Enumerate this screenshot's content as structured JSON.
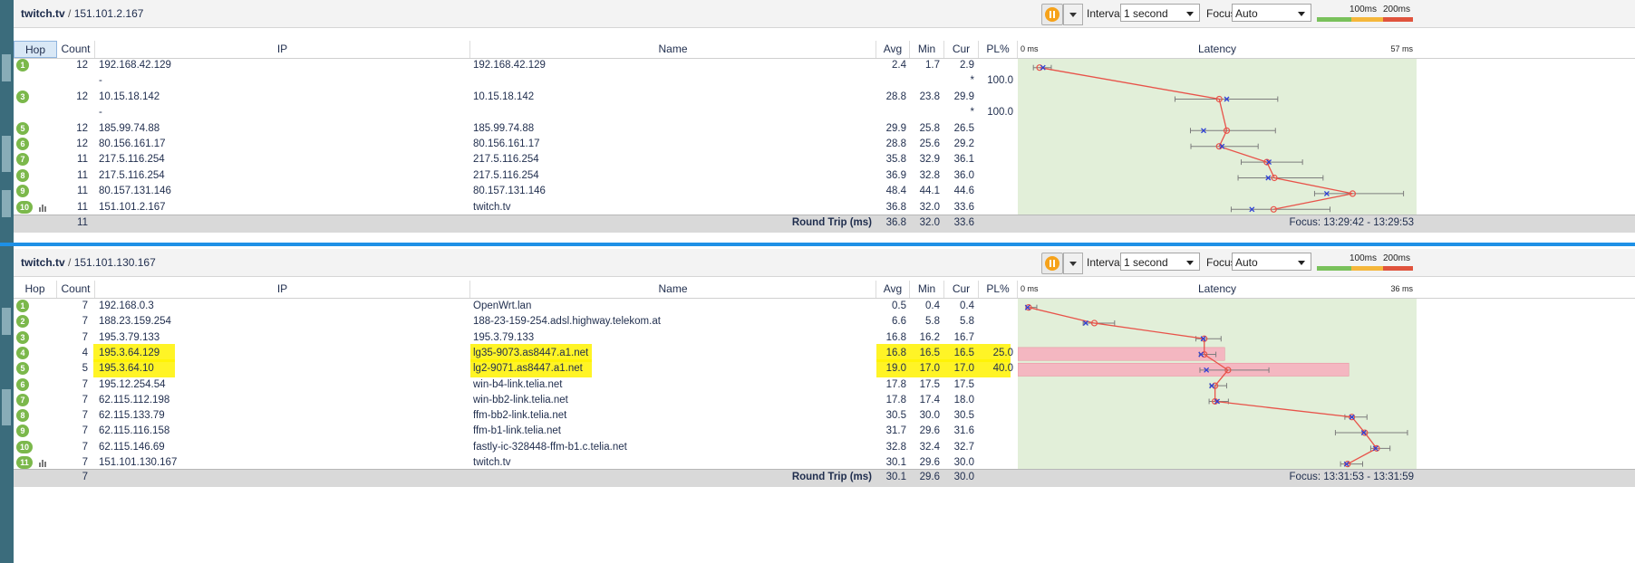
{
  "top": {
    "title_host": "twitch.tv",
    "title_ip": "151.101.2.167",
    "interval_label": "Interval",
    "interval_value": "1 second",
    "focus_label": "Focus",
    "focus_value": "Auto",
    "scale": {
      "t1": "100ms",
      "t2": "200ms",
      "colors": [
        "#79c15b",
        "#f5b73b",
        "#e0533d"
      ]
    },
    "headers": {
      "hop": "Hop",
      "count": "Count",
      "ip": "IP",
      "name": "Name",
      "avg": "Avg",
      "min": "Min",
      "cur": "Cur",
      "pl": "PL%",
      "latency": "Latency"
    },
    "chart": {
      "min_label": "0 ms",
      "max_label": "57 ms",
      "max": 57
    },
    "rows": [
      {
        "hop": "1",
        "count": "12",
        "ip": "192.168.42.129",
        "name": "192.168.42.129",
        "avg": "2.4",
        "min": "1.7",
        "cur": "2.9",
        "pl": ""
      },
      {
        "hop": "",
        "count": "",
        "ip": "-",
        "name": "",
        "avg": "",
        "min": "",
        "cur": "*",
        "pl": "100.0"
      },
      {
        "hop": "3",
        "count": "12",
        "ip": "10.15.18.142",
        "name": "10.15.18.142",
        "avg": "28.8",
        "min": "23.8",
        "cur": "29.9",
        "pl": ""
      },
      {
        "hop": "",
        "count": "",
        "ip": "-",
        "name": "",
        "avg": "",
        "min": "",
        "cur": "*",
        "pl": "100.0"
      },
      {
        "hop": "5",
        "count": "12",
        "ip": "185.99.74.88",
        "name": "185.99.74.88",
        "avg": "29.9",
        "min": "25.8",
        "cur": "26.5",
        "pl": ""
      },
      {
        "hop": "6",
        "count": "12",
        "ip": "80.156.161.17",
        "name": "80.156.161.17",
        "avg": "28.8",
        "min": "25.6",
        "cur": "29.2",
        "pl": ""
      },
      {
        "hop": "7",
        "count": "11",
        "ip": "217.5.116.254",
        "name": "217.5.116.254",
        "avg": "35.8",
        "min": "32.9",
        "cur": "36.1",
        "pl": ""
      },
      {
        "hop": "8",
        "count": "11",
        "ip": "217.5.116.254",
        "name": "217.5.116.254",
        "avg": "36.9",
        "min": "32.8",
        "cur": "36.0",
        "pl": ""
      },
      {
        "hop": "9",
        "count": "11",
        "ip": "80.157.131.146",
        "name": "80.157.131.146",
        "avg": "48.4",
        "min": "44.1",
        "cur": "44.6",
        "pl": ""
      },
      {
        "hop": "10",
        "count": "11",
        "ip": "151.101.2.167",
        "name": "twitch.tv",
        "avg": "36.8",
        "min": "32.0",
        "cur": "33.6",
        "pl": ""
      }
    ],
    "footer": {
      "count": "11",
      "rt_label": "Round Trip (ms)",
      "avg": "36.8",
      "min": "32.0",
      "cur": "33.6",
      "focus_range": "Focus: 13:29:42 - 13:29:53"
    }
  },
  "bottom": {
    "title_host": "twitch.tv",
    "title_ip": "151.101.130.167",
    "interval_label": "Interval",
    "interval_value": "1 second",
    "focus_label": "Focus",
    "focus_value": "Auto",
    "scale": {
      "t1": "100ms",
      "t2": "200ms",
      "colors": [
        "#79c15b",
        "#f5b73b",
        "#e0533d"
      ]
    },
    "headers": {
      "hop": "Hop",
      "count": "Count",
      "ip": "IP",
      "name": "Name",
      "avg": "Avg",
      "min": "Min",
      "cur": "Cur",
      "pl": "PL%",
      "latency": "Latency"
    },
    "chart": {
      "min_label": "0 ms",
      "max_label": "36 ms",
      "max": 36
    },
    "rows": [
      {
        "hop": "1",
        "count": "7",
        "ip": "192.168.0.3",
        "name": "OpenWrt.lan",
        "avg": "0.5",
        "min": "0.4",
        "cur": "0.4",
        "pl": ""
      },
      {
        "hop": "2",
        "count": "7",
        "ip": "188.23.159.254",
        "name": "188-23-159-254.adsl.highway.telekom.at",
        "avg": "6.6",
        "min": "5.8",
        "cur": "5.8",
        "pl": ""
      },
      {
        "hop": "3",
        "count": "7",
        "ip": "195.3.79.133",
        "name": "195.3.79.133",
        "avg": "16.8",
        "min": "16.2",
        "cur": "16.7",
        "pl": ""
      },
      {
        "hop": "4",
        "count": "4",
        "ip": "195.3.64.129",
        "name": "lg35-9073.as8447.a1.net",
        "avg": "16.8",
        "min": "16.5",
        "cur": "16.5",
        "pl": "25.0"
      },
      {
        "hop": "5",
        "count": "5",
        "ip": "195.3.64.10",
        "name": "lg2-9071.as8447.a1.net",
        "avg": "19.0",
        "min": "17.0",
        "cur": "17.0",
        "pl": "40.0"
      },
      {
        "hop": "6",
        "count": "7",
        "ip": "195.12.254.54",
        "name": "win-b4-link.telia.net",
        "avg": "17.8",
        "min": "17.5",
        "cur": "17.5",
        "pl": ""
      },
      {
        "hop": "7",
        "count": "7",
        "ip": "62.115.112.198",
        "name": "win-bb2-link.telia.net",
        "avg": "17.8",
        "min": "17.4",
        "cur": "18.0",
        "pl": ""
      },
      {
        "hop": "8",
        "count": "7",
        "ip": "62.115.133.79",
        "name": "ffm-bb2-link.telia.net",
        "avg": "30.5",
        "min": "30.0",
        "cur": "30.5",
        "pl": ""
      },
      {
        "hop": "9",
        "count": "7",
        "ip": "62.115.116.158",
        "name": "ffm-b1-link.telia.net",
        "avg": "31.7",
        "min": "29.6",
        "cur": "31.6",
        "pl": ""
      },
      {
        "hop": "10",
        "count": "7",
        "ip": "62.115.146.69",
        "name": "fastly-ic-328448-ffm-b1.c.telia.net",
        "avg": "32.8",
        "min": "32.4",
        "cur": "32.7",
        "pl": ""
      },
      {
        "hop": "11",
        "count": "7",
        "ip": "151.101.130.167",
        "name": "twitch.tv",
        "avg": "30.1",
        "min": "29.6",
        "cur": "30.0",
        "pl": ""
      }
    ],
    "footer": {
      "count": "7",
      "rt_label": "Round Trip (ms)",
      "avg": "30.1",
      "min": "29.6",
      "cur": "30.0",
      "focus_range": "Focus: 13:31:53 - 13:31:59"
    }
  },
  "colors": {
    "accent_blue": "#1e90e6",
    "hop_green": "#7bb84b",
    "latency_bg": "#e2efd9",
    "loss_bar": "#f4b7c1",
    "highlight": "#fff200",
    "line_red": "#e8534a",
    "marker_blue": "#2d3fd6"
  }
}
